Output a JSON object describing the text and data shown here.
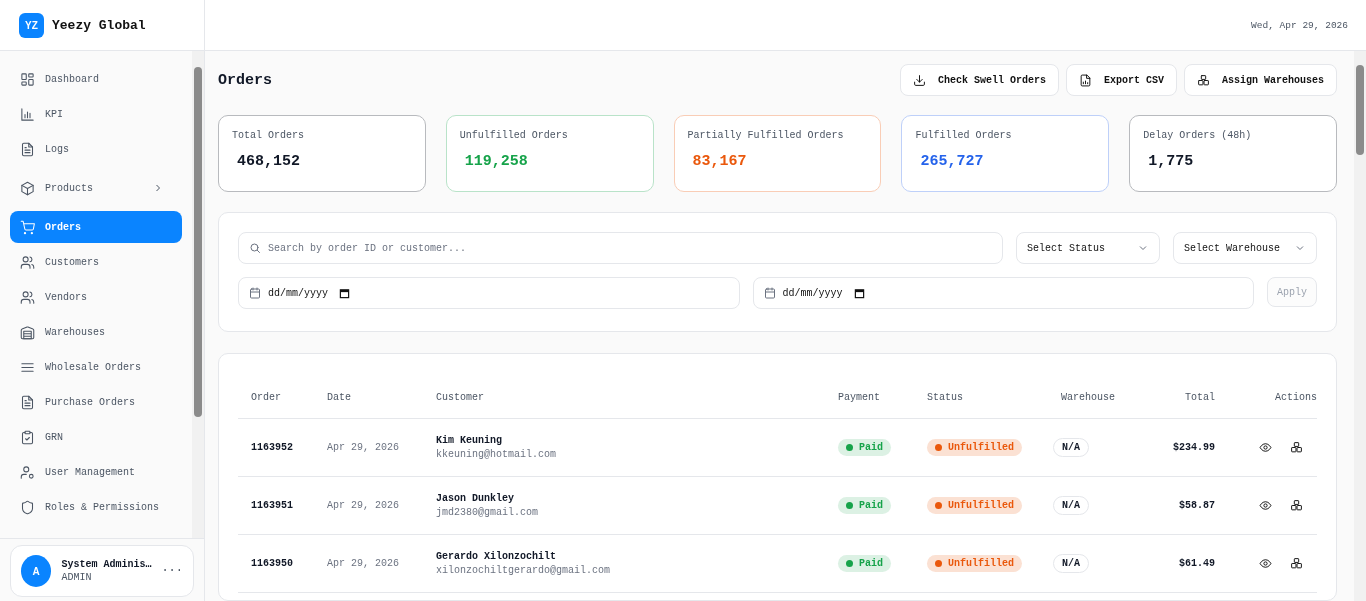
{
  "brand": {
    "logo": "YZ",
    "name": "Yeezy Global"
  },
  "header": {
    "date": "Wed, Apr 29, 2026"
  },
  "sidebar": {
    "items": [
      {
        "label": "Dashboard",
        "kind": "grid",
        "selected": false
      },
      {
        "label": "KPI",
        "kind": "chart",
        "selected": false
      },
      {
        "label": "Logs",
        "kind": "doc",
        "selected": false
      },
      {
        "label": "Products",
        "kind": "box",
        "selected": false,
        "expandable": true
      },
      {
        "label": "Orders",
        "kind": "cart",
        "selected": true
      },
      {
        "label": "Customers",
        "kind": "users",
        "selected": false
      },
      {
        "label": "Vendors",
        "kind": "users",
        "selected": false
      },
      {
        "label": "Warehouses",
        "kind": "warehouse",
        "selected": false
      },
      {
        "label": "Wholesale Orders",
        "kind": "lines",
        "selected": false
      },
      {
        "label": "Purchase Orders",
        "kind": "doc",
        "selected": false
      },
      {
        "label": "GRN",
        "kind": "clipboard",
        "selected": false
      },
      {
        "label": "User Management",
        "kind": "usercog",
        "selected": false
      },
      {
        "label": "Roles & Permissions",
        "kind": "shield",
        "selected": false
      }
    ],
    "user": {
      "avatar": "A",
      "name": "System Adminis…",
      "role": "ADMIN",
      "menu": "···"
    }
  },
  "page": {
    "title": "Orders",
    "actions": [
      {
        "label": "Check Swell Orders",
        "kind": "download"
      },
      {
        "label": "Export CSV",
        "kind": "file"
      },
      {
        "label": "Assign Warehouses",
        "kind": "boxes"
      }
    ]
  },
  "stats": [
    {
      "label": "Total Orders",
      "value": "468,152",
      "color": "#111827"
    },
    {
      "label": "Unfulfilled Orders",
      "value": "119,258",
      "color": "#16a34a"
    },
    {
      "label": "Partially Fulfilled Orders",
      "value": "83,167",
      "color": "#ea580c"
    },
    {
      "label": "Fulfilled Orders",
      "value": "265,727",
      "color": "#2563eb"
    },
    {
      "label": "Delay Orders (48h)",
      "value": "1,775",
      "color": "#111827"
    }
  ],
  "filters": {
    "search": {
      "placeholder": "Search by order ID or customer..."
    },
    "status": {
      "placeholder": "Select Status"
    },
    "warehouse": {
      "placeholder": "Select Warehouse"
    },
    "date_from": {
      "placeholder": "dd/mm/yyyy"
    },
    "date_to": {
      "placeholder": "dd/mm/yyyy"
    },
    "apply": {
      "label": "Apply",
      "disabled": true
    }
  },
  "table": {
    "columns": [
      "Order",
      "Date",
      "Customer",
      "Payment",
      "Status",
      "Warehouse",
      "Total",
      "Actions"
    ],
    "rows": [
      {
        "order": "1163952",
        "date": "Apr 29, 2026",
        "name": "Kim Keuning",
        "email": "kkeuning@hotmail.com",
        "payment": {
          "label": "Paid",
          "color": "#16a34a"
        },
        "status": {
          "label": "Unfulfilled",
          "color": "#ea580c"
        },
        "warehouse": "N/A",
        "total": "$234.99"
      },
      {
        "order": "1163951",
        "date": "Apr 29, 2026",
        "name": "Jason Dunkley",
        "email": "jmd2380@gmail.com",
        "payment": {
          "label": "Paid",
          "color": "#16a34a"
        },
        "status": {
          "label": "Unfulfilled",
          "color": "#ea580c"
        },
        "warehouse": "N/A",
        "total": "$58.87"
      },
      {
        "order": "1163950",
        "date": "Apr 29, 2026",
        "name": "Gerardo Xilonzochilt",
        "email": "xilonzochiltgerardo@gmail.com",
        "payment": {
          "label": "Paid",
          "color": "#16a34a"
        },
        "status": {
          "label": "Unfulfilled",
          "color": "#ea580c"
        },
        "warehouse": "N/A",
        "total": "$61.49"
      }
    ]
  }
}
